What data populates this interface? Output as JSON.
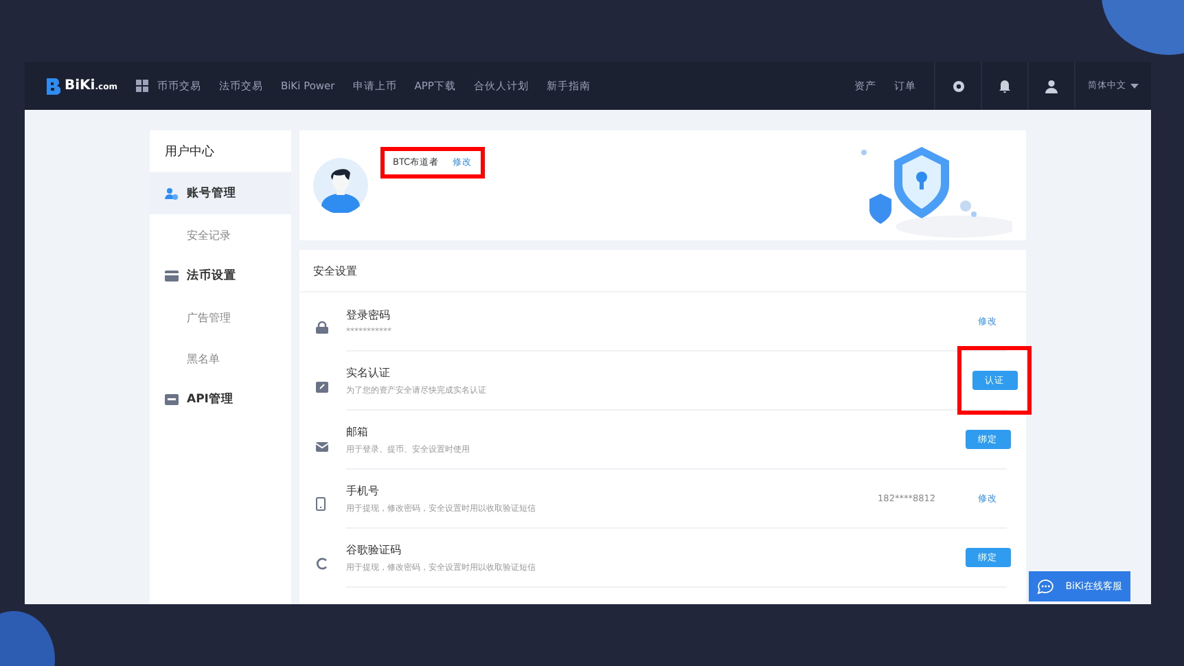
{
  "navbar": {
    "logo": {
      "name": "BiKi",
      "suffix": ".com"
    },
    "menu": [
      "币币交易",
      "法币交易",
      "BiKi Power",
      "申请上币",
      "APP下载",
      "合伙人计划",
      "新手指南"
    ],
    "right_links": [
      "资产",
      "订单"
    ],
    "language": "简体中文"
  },
  "sidebar": {
    "title": "用户中心",
    "items": [
      {
        "label": "账号管理",
        "kind": "users",
        "selected": true,
        "children": [
          {
            "label": "安全记录",
            "selected": false
          }
        ]
      },
      {
        "label": "法币设置",
        "kind": "card",
        "selected": false,
        "children": [
          {
            "label": "广告管理",
            "selected": false
          },
          {
            "label": "黑名单",
            "selected": false
          }
        ]
      },
      {
        "label": "API管理",
        "kind": "api",
        "selected": false
      }
    ]
  },
  "profile": {
    "username": "BTC布道者",
    "edit": "修改",
    "highlighted": true
  },
  "security": {
    "title": "安全设置",
    "rows": [
      {
        "kind": "lock",
        "title": "登录密码",
        "desc": "***********",
        "value": null,
        "action": {
          "kind": "link",
          "label": "修改",
          "highlighted": false
        }
      },
      {
        "kind": "id",
        "title": "实名认证",
        "desc": "为了您的资产安全请尽快完成实名认证",
        "value": null,
        "action": {
          "kind": "button",
          "label": "认证",
          "highlighted": true
        }
      },
      {
        "kind": "mail",
        "title": "邮箱",
        "desc": "用于登录、提币、安全设置时使用",
        "value": null,
        "action": {
          "kind": "button",
          "label": "绑定",
          "highlighted": false
        }
      },
      {
        "kind": "phone",
        "title": "手机号",
        "desc": "用于提现，修改密码，安全设置时用以收取验证短信",
        "value": "182****8812",
        "action": {
          "kind": "link",
          "label": "修改",
          "highlighted": false
        }
      },
      {
        "kind": "google",
        "title": "谷歌验证码",
        "desc": "用于提现，修改密码，安全设置时用以收取验证短信",
        "value": null,
        "action": {
          "kind": "button",
          "label": "绑定",
          "highlighted": false
        }
      }
    ]
  },
  "chat_button": "BiKi在线客服"
}
